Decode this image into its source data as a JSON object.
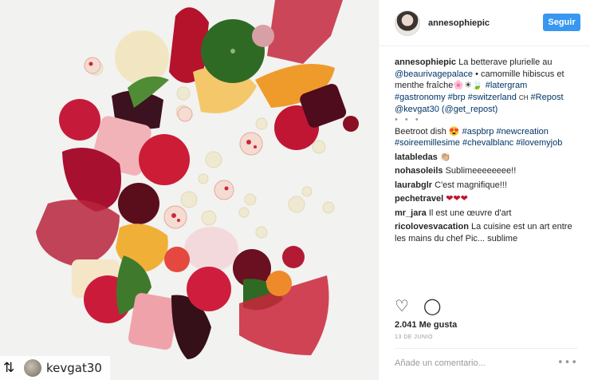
{
  "post": {
    "photo_alt": "Beetroot dish plated on a white plate",
    "repost_username": "kevgat30",
    "repost_icon": "repost-icon"
  },
  "header": {
    "username": "annesophiepic",
    "follow_label": "Seguir"
  },
  "caption": {
    "username": "annesophiepic",
    "text_1": "La betterave plurielle au",
    "tag_1": "@beaurivagepalace",
    "text_2": "• camomille hibiscus et menthe fraîche🌸☀🍃",
    "tags_2": "#latergram #gastronomy #brp #switzerland",
    "text_3": "CH",
    "tags_3": "#Repost @kevgat30 (@get_repost)",
    "dots": "• • •",
    "line_4": "Beetroot dish 😍",
    "tags_4": "#aspbrp #newcreation #soireemillesime #chevalblanc #ilovemyjob"
  },
  "comments": [
    {
      "user": "latabledas",
      "text": "👏🏼"
    },
    {
      "user": "nohasoleils",
      "text": "Sublimeeeeeeee!!"
    },
    {
      "user": "laurabglr",
      "text": "C'est magnifique!!!"
    },
    {
      "user": "pechetravel",
      "text": "❤❤❤"
    },
    {
      "user": "mr_jara",
      "text": "Il est une œuvre d'art"
    },
    {
      "user": "ricolovesvacation",
      "text": "La cuisine est un art entre les mains du chef Pic... sublime"
    }
  ],
  "footer": {
    "likes": "2.041 Me gusta",
    "date": "13 DE JUNIO",
    "comment_placeholder": "Añade un comentario...",
    "more_label": "•••"
  },
  "icons": {
    "like": "heart-outline-icon",
    "comment": "speech-bubble-icon",
    "more": "more-options-icon"
  },
  "colors": {
    "follow_button": "#3897f0",
    "hashtag": "#003569",
    "beet_red": "#b5122c"
  }
}
